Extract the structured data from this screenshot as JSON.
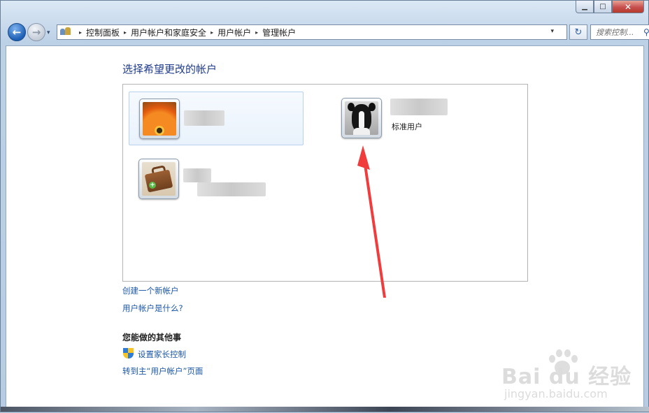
{
  "window": {
    "caption_buttons": [
      {
        "name": "minimize-button",
        "glyph": "▁"
      },
      {
        "name": "maximize-button",
        "glyph": "□"
      },
      {
        "name": "close-button",
        "glyph": "✕"
      }
    ]
  },
  "nav": {
    "back_glyph": "←",
    "forward_glyph": "→",
    "dropdown_glyph": "▾",
    "refresh_glyph": "↻",
    "breadcrumbs": [
      "控制面板",
      "用户帐户和家庭安全",
      "用户帐户",
      "管理帐户"
    ],
    "crumb_sep": "▸",
    "address_icon": "control-panel-icon",
    "search_placeholder": "搜索控制...",
    "search_icon": "magnifier-icon",
    "search_glyph": "⚲"
  },
  "main": {
    "heading": "选择希望更改的帐户",
    "accounts": [
      {
        "picture": "orange-flower",
        "type": "",
        "selected": true
      },
      {
        "picture": "dog",
        "type": "标准用户",
        "selected": false
      },
      {
        "picture": "briefcase",
        "type": "",
        "selected": false
      }
    ],
    "links": {
      "create_account": "创建一个新帐户",
      "what_is_account": "用户帐户是什么?"
    },
    "other_heading": "您能做的其他事",
    "parental_control": "设置家长控制",
    "goto_main": "转到主“用户帐户”页面"
  },
  "annotation": {
    "color": "#f03c3c"
  },
  "watermark": {
    "logo": "Bai du 经验",
    "url": "jingyan.baidu.com"
  }
}
